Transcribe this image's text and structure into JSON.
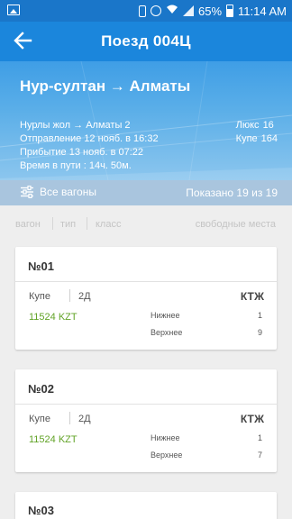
{
  "status_bar": {
    "battery": "65%",
    "time": "11:14 AM",
    "icons": [
      "image-icon",
      "phone-icon",
      "alarm-icon",
      "wifi-icon",
      "signal-icon",
      "battery-icon"
    ]
  },
  "toolbar": {
    "title": "Поезд 004Ц"
  },
  "hero": {
    "route": "Нур-султан → Алматы",
    "stations": "Нурлы жол → Алматы 2",
    "departure": "Отправление 12 нояб. в 16:32",
    "arrival": "Прибытие 13 нояб. в 07:22",
    "duration": "Время в пути : 14ч. 50м.",
    "classes": [
      {
        "name": "Люкс",
        "count": "16"
      },
      {
        "name": "Купе",
        "count": "164"
      }
    ]
  },
  "filter": {
    "all_wagons": "Все вагоны",
    "shown": "Показано 19 из 19"
  },
  "columns": {
    "wagon": "вагон",
    "type": "тип",
    "class": "класс",
    "free_seats": "свободные места"
  },
  "wagons": [
    {
      "number": "№01",
      "type": "Купе",
      "class": "2Д",
      "carrier": "КТЖ",
      "price": "11524 KZT",
      "seats": [
        {
          "label": "Нижнее",
          "count": "1"
        },
        {
          "label": "Верхнее",
          "count": "9"
        }
      ]
    },
    {
      "number": "№02",
      "type": "Купе",
      "class": "2Д",
      "carrier": "КТЖ",
      "price": "11524 KZT",
      "seats": [
        {
          "label": "Нижнее",
          "count": "1"
        },
        {
          "label": "Верхнее",
          "count": "7"
        }
      ]
    },
    {
      "number": "№03"
    }
  ],
  "colors": {
    "status_bar": "#1a76c9",
    "toolbar": "#1b86dc",
    "filter_bar": "#a9c5de",
    "price": "#62a327"
  }
}
